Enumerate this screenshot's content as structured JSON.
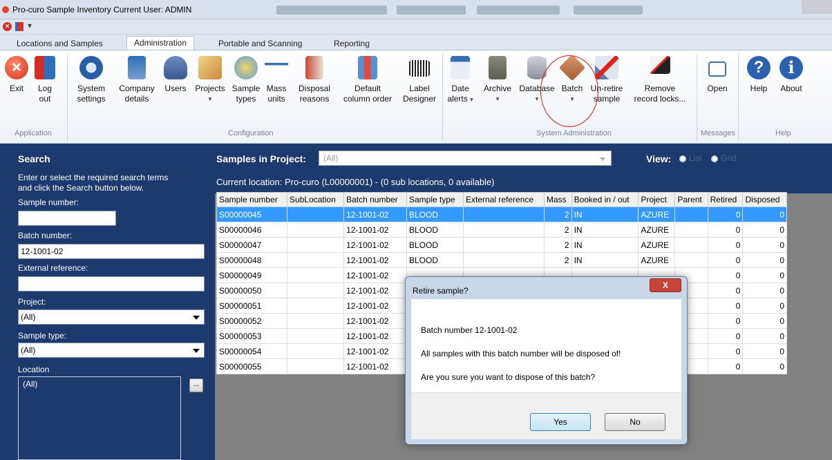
{
  "window": {
    "title": "Pro-curo Sample Inventory   Current User: ADMIN"
  },
  "qat": {
    "dropdown_glyph": "▾"
  },
  "tabs": [
    "Locations and Samples",
    "Administration",
    "Portable and Scanning",
    "Reporting"
  ],
  "ribbon": {
    "application": {
      "group": "Application",
      "exit": "Exit",
      "logout1": "Log",
      "logout2": "out"
    },
    "configuration": {
      "group": "Configuration",
      "system_settings1": "System",
      "system_settings2": "settings",
      "company1": "Company",
      "company2": "details",
      "users": "Users",
      "projects": "Projects",
      "sample_types1": "Sample",
      "sample_types2": "types",
      "mass1": "Mass",
      "mass2": "units",
      "disposal1": "Disposal",
      "disposal2": "reasons",
      "default_col1": "Default",
      "default_col2": "column order",
      "label1": "Label",
      "label2": "Designer"
    },
    "system_admin": {
      "group": "System Administration",
      "date1": "Date",
      "date2": "alerts",
      "archive": "Archive",
      "database": "Database",
      "batch": "Batch",
      "unretire1": "Un-retire",
      "unretire2": "sample",
      "remove1": "Remove",
      "remove2": "record locks..."
    },
    "messages": {
      "group": "Messages",
      "open": "Open"
    },
    "help": {
      "group": "Help",
      "help": "Help",
      "about": "About"
    }
  },
  "search": {
    "title": "Search",
    "instructions1": "Enter or select the required search terms",
    "instructions2": "and click the Search button below.",
    "sample_number_label": "Sample number:",
    "sample_number_value": "",
    "batch_number_label": "Batch number:",
    "batch_number_value": "12-1001-02",
    "external_ref_label": "External reference:",
    "external_ref_value": "",
    "project_label": "Project:",
    "project_value": "(All)",
    "sample_type_label": "Sample type:",
    "sample_type_value": "(All)",
    "location_label": "Location",
    "location_value": "(All)",
    "browse_button": "..."
  },
  "samples": {
    "project_label": "Samples in Project:",
    "project_value": "(All)",
    "view_label": "View:",
    "view_list": "List",
    "view_grid": "Grid",
    "current_location": "Current location: Pro-curo  (L00000001)  -  (0 sub locations, 0 available)",
    "columns": [
      "Sample number",
      "SubLocation",
      "Batch number",
      "Sample type",
      "External reference",
      "Mass",
      "Booked in / out",
      "Project",
      "Parent",
      "Retired",
      "Disposed"
    ],
    "rows": [
      [
        "S00000045",
        "",
        "12-1001-02",
        "BLOOD",
        "",
        "2",
        "IN",
        "AZURE",
        "",
        "0",
        "0"
      ],
      [
        "S00000046",
        "",
        "12-1001-02",
        "BLOOD",
        "",
        "2",
        "IN",
        "AZURE",
        "",
        "0",
        "0"
      ],
      [
        "S00000047",
        "",
        "12-1001-02",
        "BLOOD",
        "",
        "2",
        "IN",
        "AZURE",
        "",
        "0",
        "0"
      ],
      [
        "S00000048",
        "",
        "12-1001-02",
        "BLOOD",
        "",
        "2",
        "IN",
        "AZURE",
        "",
        "0",
        "0"
      ],
      [
        "S00000049",
        "",
        "12-1001-02",
        "",
        "",
        "",
        "",
        "",
        "",
        "0",
        "0"
      ],
      [
        "S00000050",
        "",
        "12-1001-02",
        "",
        "",
        "",
        "",
        "",
        "",
        "0",
        "0"
      ],
      [
        "S00000051",
        "",
        "12-1001-02",
        "",
        "",
        "",
        "",
        "",
        "",
        "0",
        "0"
      ],
      [
        "S00000052",
        "",
        "12-1001-02",
        "",
        "",
        "",
        "",
        "",
        "",
        "0",
        "0"
      ],
      [
        "S00000053",
        "",
        "12-1001-02",
        "",
        "",
        "",
        "",
        "",
        "",
        "0",
        "0"
      ],
      [
        "S00000054",
        "",
        "12-1001-02",
        "",
        "",
        "",
        "",
        "",
        "",
        "0",
        "0"
      ],
      [
        "S00000055",
        "",
        "12-1001-02",
        "",
        "",
        "",
        "",
        "",
        "",
        "0",
        "0"
      ]
    ]
  },
  "dialog": {
    "title": "Retire sample?",
    "close": "X",
    "line1": "Batch number  12-1001-02",
    "line2": "All samples with this batch number will be disposed of!",
    "line3": "Are you sure you want to dispose of this batch?",
    "yes": "Yes",
    "no": "No"
  },
  "colors": {
    "panel_navy": "#1c3a6e",
    "selection_blue": "#3399ff",
    "annotation_red": "#e01010"
  }
}
